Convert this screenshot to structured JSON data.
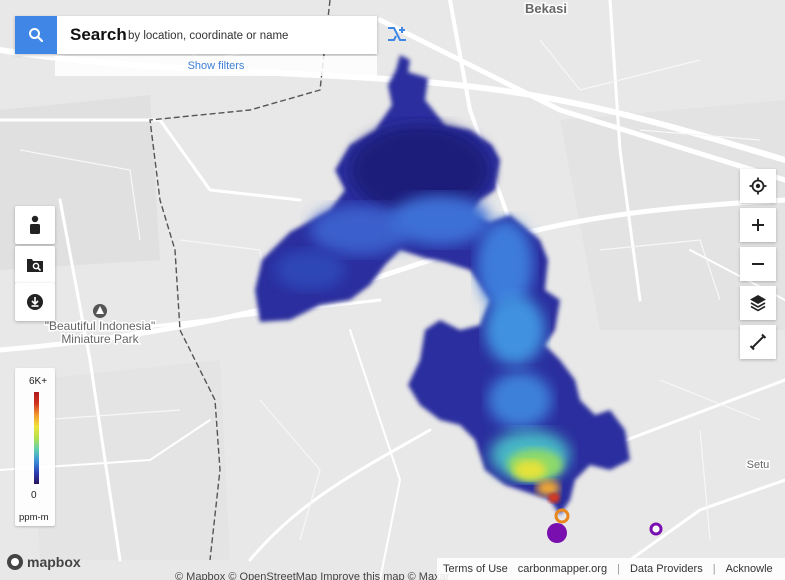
{
  "search": {
    "title": "Search",
    "hint": "by location, coordinate or name",
    "show_filters": "Show filters"
  },
  "places": {
    "bekasi": "Bekasi",
    "setu": "Setu",
    "park_line1": "\"Beautiful Indonesia\"",
    "park_line2": "Miniature Park"
  },
  "legend": {
    "max": "6K+",
    "min": "0",
    "unit": "ppm-m"
  },
  "attribution": {
    "logo": "mapbox",
    "terms": "Terms of Use",
    "site": "carbonmapper.org",
    "providers": "Data Providers",
    "acknowledge": "Acknowle"
  },
  "bottom_note": "© Mapbox © OpenStreetMap Improve this map © Maxar",
  "colors": {
    "search_blue": "#3f86e7",
    "plume_low": "#27135d",
    "plume_high": "#b0191f",
    "source_marker": "#7a0fb0"
  },
  "icons": {
    "search": "search-icon",
    "filter": "filter-icon",
    "person": "person-icon",
    "image_search": "image-search-icon",
    "download": "download-icon",
    "locate": "crosshair-icon",
    "zoom_in": "plus-icon",
    "zoom_out": "minus-icon",
    "layers": "layers-icon",
    "measure": "ruler-icon"
  }
}
